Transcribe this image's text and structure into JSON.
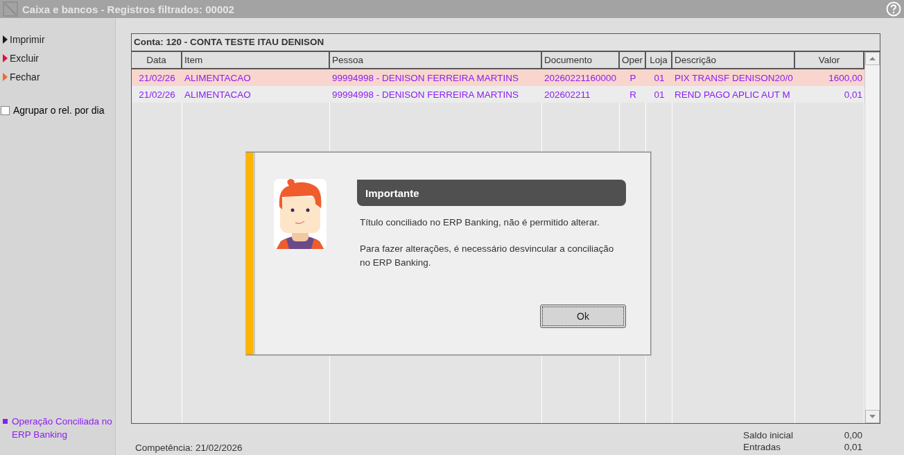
{
  "window": {
    "title": "Caixa e bancos - Registros filtrados: 00002"
  },
  "sidebar": {
    "actions": [
      {
        "label": "Imprimir",
        "color": "#1a1a1a"
      },
      {
        "label": "Excluir",
        "color": "#e0103c"
      },
      {
        "label": "Fechar",
        "color": "#f06a2a"
      }
    ],
    "group_by_day": {
      "label": "Agrupar o rel. por dia",
      "checked": false
    },
    "legend": {
      "label": "Operação Conciliada no ERP Banking",
      "color": "#8a1ef0"
    }
  },
  "grid": {
    "account": "Conta: 120 - CONTA TESTE ITAU DENISON",
    "columns": [
      "Data",
      "Item",
      "Pessoa",
      "Documento",
      "Oper",
      "Loja",
      "Descrição",
      "Valor"
    ],
    "rows": [
      {
        "selected": true,
        "conciliated": true,
        "cells": [
          "21/02/26",
          "ALIMENTACAO",
          "99994998 - DENISON FERREIRA MARTINS",
          "20260221160000",
          "P",
          "01",
          "PIX TRANSF DENISON20/0",
          "1600,00"
        ]
      },
      {
        "selected": false,
        "conciliated": true,
        "cells": [
          "21/02/26",
          "ALIMENTACAO",
          "99994998 - DENISON FERREIRA MARTINS",
          "202602211",
          "R",
          "01",
          "REND PAGO APLIC AUT M",
          "0,01"
        ]
      }
    ]
  },
  "footer": {
    "competencia": "Competência: 21/02/2026",
    "totals": [
      {
        "label": "Saldo inicial",
        "value": "0,00"
      },
      {
        "label": "Entradas",
        "value": "0,01"
      }
    ]
  },
  "dialog": {
    "title": "Importante",
    "messages": [
      "Título conciliado no ERP Banking, não é permitido alterar.",
      "Para fazer alterações, é necessário desvincular a conciliação no ERP Banking."
    ],
    "button": "Ok"
  }
}
